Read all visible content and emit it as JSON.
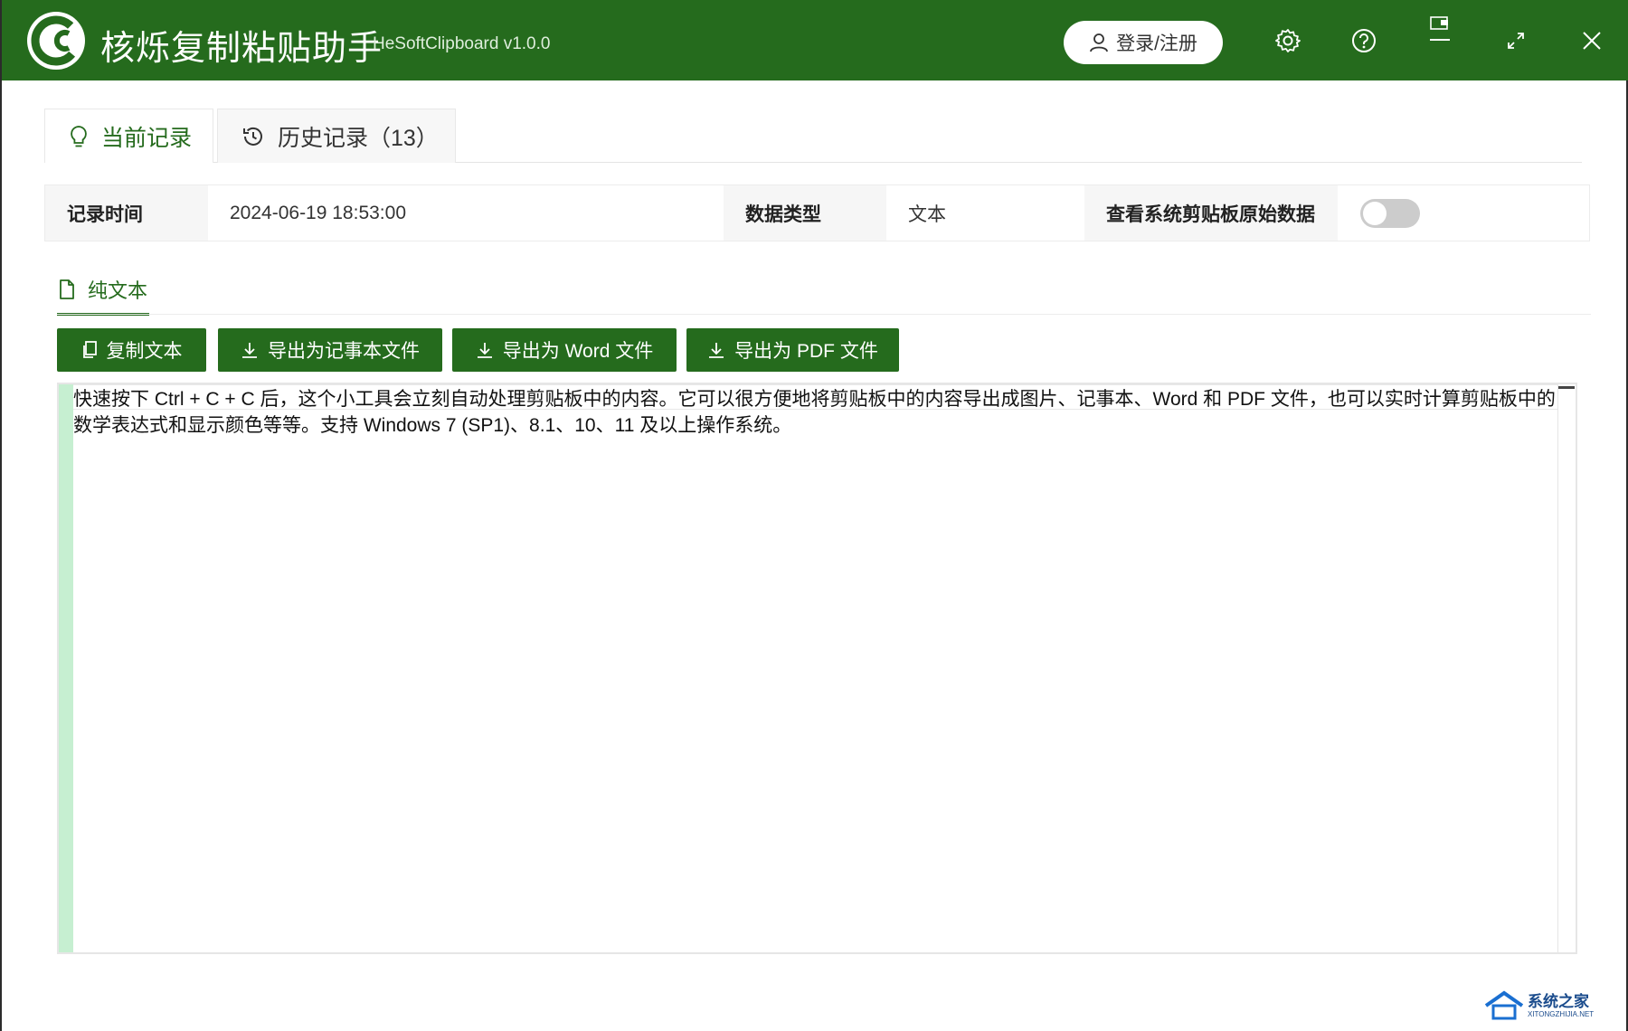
{
  "app": {
    "title": "核烁复制粘贴助手",
    "version": "HeSoftClipboard v1.0.0",
    "login_label": "登录/注册"
  },
  "titlebar_icons": [
    "user-icon",
    "gear-icon",
    "help-icon",
    "pin-to-top-icon",
    "minimize-icon",
    "maximize-icon",
    "close-icon"
  ],
  "tabs": [
    {
      "label": "当前记录",
      "icon": "lightbulb-icon",
      "active": true
    },
    {
      "label": "历史记录（13）",
      "icon": "history-clock-icon",
      "active": false
    }
  ],
  "info": {
    "time_label": "记录时间",
    "time_value": "2024-06-19 18:53:00",
    "type_label": "数据类型",
    "type_value": "文本",
    "raw_label": "查看系统剪贴板原始数据",
    "raw_toggle_on": false
  },
  "subtab": {
    "label": "纯文本",
    "icon": "file-icon"
  },
  "actions": [
    {
      "label": "复制文本",
      "icon": "copy-icon"
    },
    {
      "label": "导出为记事本文件",
      "icon": "download-icon"
    },
    {
      "label": "导出为 Word 文件",
      "icon": "download-icon"
    },
    {
      "label": "导出为 PDF 文件",
      "icon": "download-icon"
    }
  ],
  "editor": {
    "content": "快速按下 Ctrl + C + C 后，这个小工具会立刻自动处理剪贴板中的内容。它可以很方便地将剪贴板中的内容导出成图片、记事本、Word 和 PDF 文件，也可以实时计算剪贴板中的数学表达式和显示颜色等等。支持 Windows 7 (SP1)、8.1、10、11 及以上操作系统。"
  },
  "watermark": {
    "text": "系统之家",
    "sub": "XITONGZHIJIA.NET"
  },
  "colors": {
    "brand": "#256b1d",
    "toggle_off": "#cccccc",
    "gutter": "#c6efd1"
  }
}
